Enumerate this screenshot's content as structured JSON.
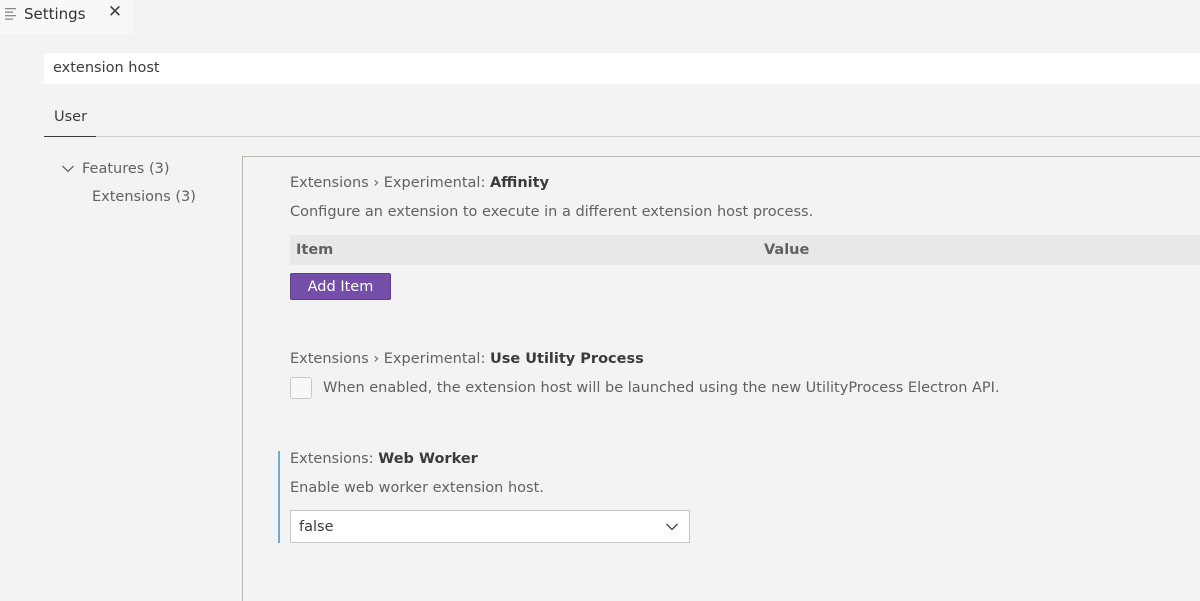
{
  "editor_tab": {
    "title": "Settings",
    "close_glyph": "✕",
    "icon": "settings-editor-icon"
  },
  "search": {
    "value": "extension host"
  },
  "scope_tabs": [
    {
      "label": "User",
      "active": true
    }
  ],
  "toc": {
    "features": "Features (3)",
    "extensions": "Extensions (3)"
  },
  "settings": [
    {
      "category": "Extensions › Experimental: ",
      "name": "Affinity",
      "description": "Configure an extension to execute in a different extension host process.",
      "table_headers": [
        "Item",
        "Value"
      ],
      "add_button_label": "Add Item"
    },
    {
      "category": "Extensions › Experimental: ",
      "name": "Use Utility Process",
      "description": "When enabled, the extension host will be launched using the new UtilityProcess Electron API.",
      "checked": false
    },
    {
      "category": "Extensions: ",
      "name": "Web Worker",
      "description": "Enable web worker extension host.",
      "selected_value": "false"
    }
  ],
  "colors": {
    "button_accent": "#744ea8",
    "focus_bar": "#6fa8dc",
    "background": "#f3f3f3"
  }
}
